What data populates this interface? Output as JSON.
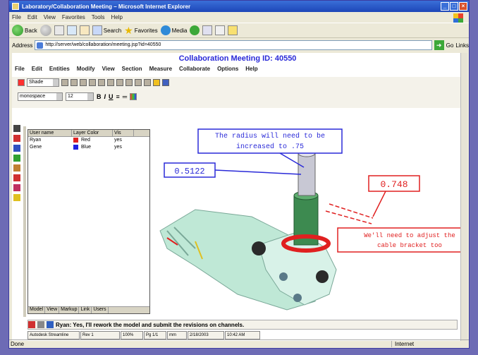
{
  "browser": {
    "title": "Laboratory/Collaboration Meeting – Microsoft Internet Explorer",
    "menu": [
      "File",
      "Edit",
      "View",
      "Favorites",
      "Tools",
      "Help"
    ],
    "toolbar": {
      "back": "Back",
      "search": "Search",
      "favorites": "Favorites",
      "media": "Media"
    },
    "address_label": "Address",
    "address": "http://server/web/collaboration/meeting.jsp?id=40550",
    "go": "Go",
    "links": "Links",
    "status": "Done",
    "zone": "Internet"
  },
  "app": {
    "meeting_title": "Collaboration Meeting ID: 40550",
    "menu": [
      "File",
      "Edit",
      "Entities",
      "Modify",
      "View",
      "Section",
      "Measure",
      "Collaborate",
      "Options",
      "Help"
    ],
    "shading_value": "Shade",
    "font_value": "monospace",
    "font_size": "12",
    "format_buttons": [
      "B",
      "I",
      "U",
      "≡",
      "═"
    ],
    "participants": {
      "columns": [
        "User name",
        "Layer Color",
        "Vis"
      ],
      "rows": [
        {
          "name": "Ryan",
          "color_name": "Red",
          "color": "#e02020",
          "vis": "yes"
        },
        {
          "name": "Gene",
          "color_name": "Blue",
          "color": "#2020e0",
          "vis": "yes"
        }
      ],
      "tabs": [
        "Model",
        "View",
        "Markup",
        "Link",
        "Users"
      ]
    },
    "annotations": {
      "blue_note": "The radius will need to be increased to .75",
      "blue_dim": "0.5122",
      "red_dim": "0.748",
      "red_note": "We'll need to adjust the cable bracket too"
    },
    "chat_message": "Ryan: Yes, I'll rework the model and submit the revisions on channels.",
    "statusbar": [
      "Autodesk Streamline",
      "Rev 1",
      "100%",
      "Pg 1/1",
      "mm",
      "2/18/2003",
      "10:42 AM"
    ],
    "colors": {
      "blue": "#2a2ad8",
      "red": "#e02020",
      "part": "#bfe8d6"
    }
  }
}
